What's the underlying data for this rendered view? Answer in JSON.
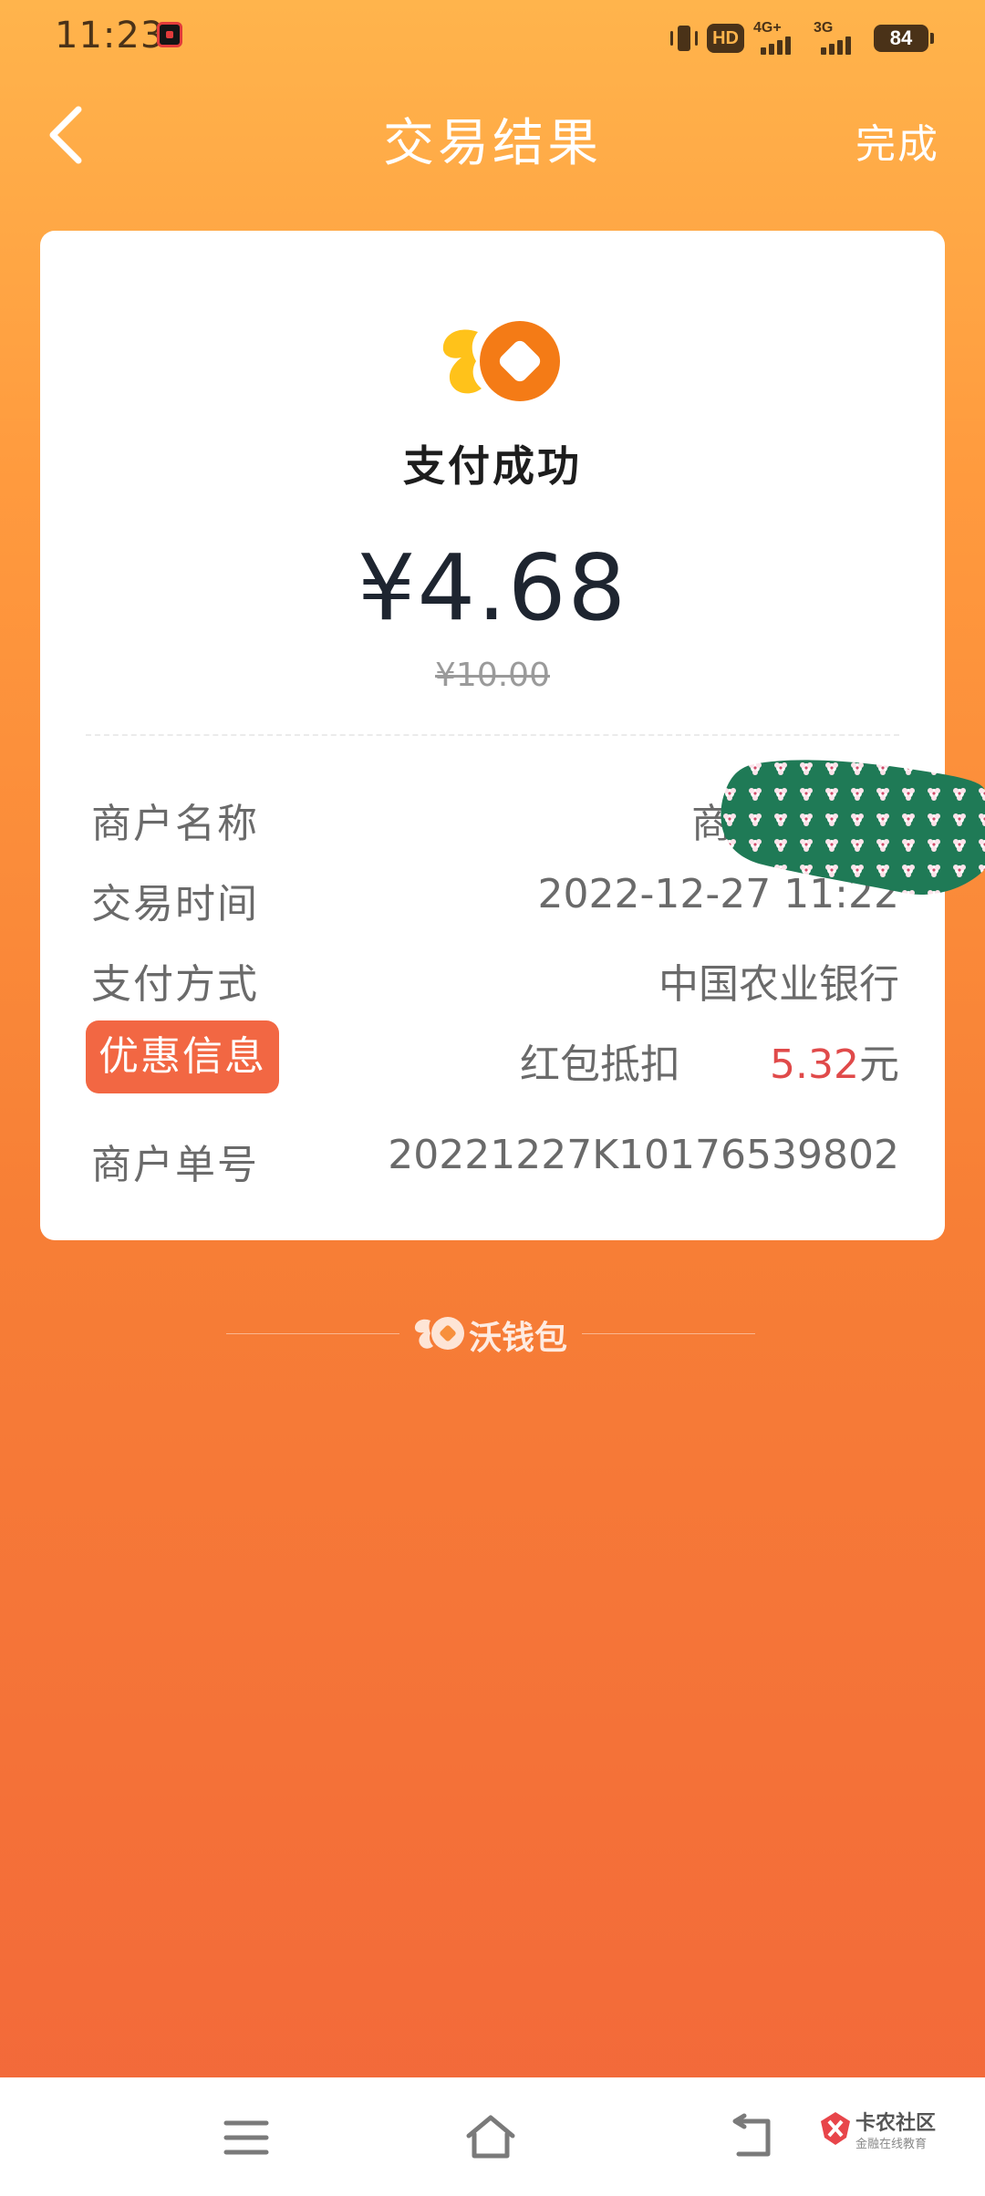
{
  "status_bar": {
    "time": "11:23",
    "hd": "HD",
    "network_1": "4G+",
    "network_2": "3G",
    "battery": "84"
  },
  "header": {
    "title": "交易结果",
    "done_label": "完成"
  },
  "card": {
    "status": "支付成功",
    "amount": "¥4.68",
    "original_amount": "¥10.00",
    "rows": {
      "merchant_name": {
        "label": "商户名称",
        "value": "商户"
      },
      "time": {
        "label": "交易时间",
        "value": "2022-12-27 11:22"
      },
      "payment": {
        "label": "支付方式",
        "value": "中国农业银行"
      },
      "promo": {
        "label": "优惠信息",
        "desc": "红包抵扣",
        "amount": "5.32",
        "unit": "元"
      },
      "order_no": {
        "label": "商户单号",
        "value": "20221227K10176539802"
      }
    }
  },
  "footer": {
    "brand": "沃钱包"
  },
  "watermark": {
    "name": "卡农社区",
    "sub": "金融在线教育"
  },
  "colors": {
    "accent": "#f77f36",
    "discount": "#e04a4a",
    "promo_tag": "#f26743",
    "logo_orange": "#f47b16",
    "logo_yellow": "#ffc21a",
    "sticker_green": "#1f7a56"
  }
}
